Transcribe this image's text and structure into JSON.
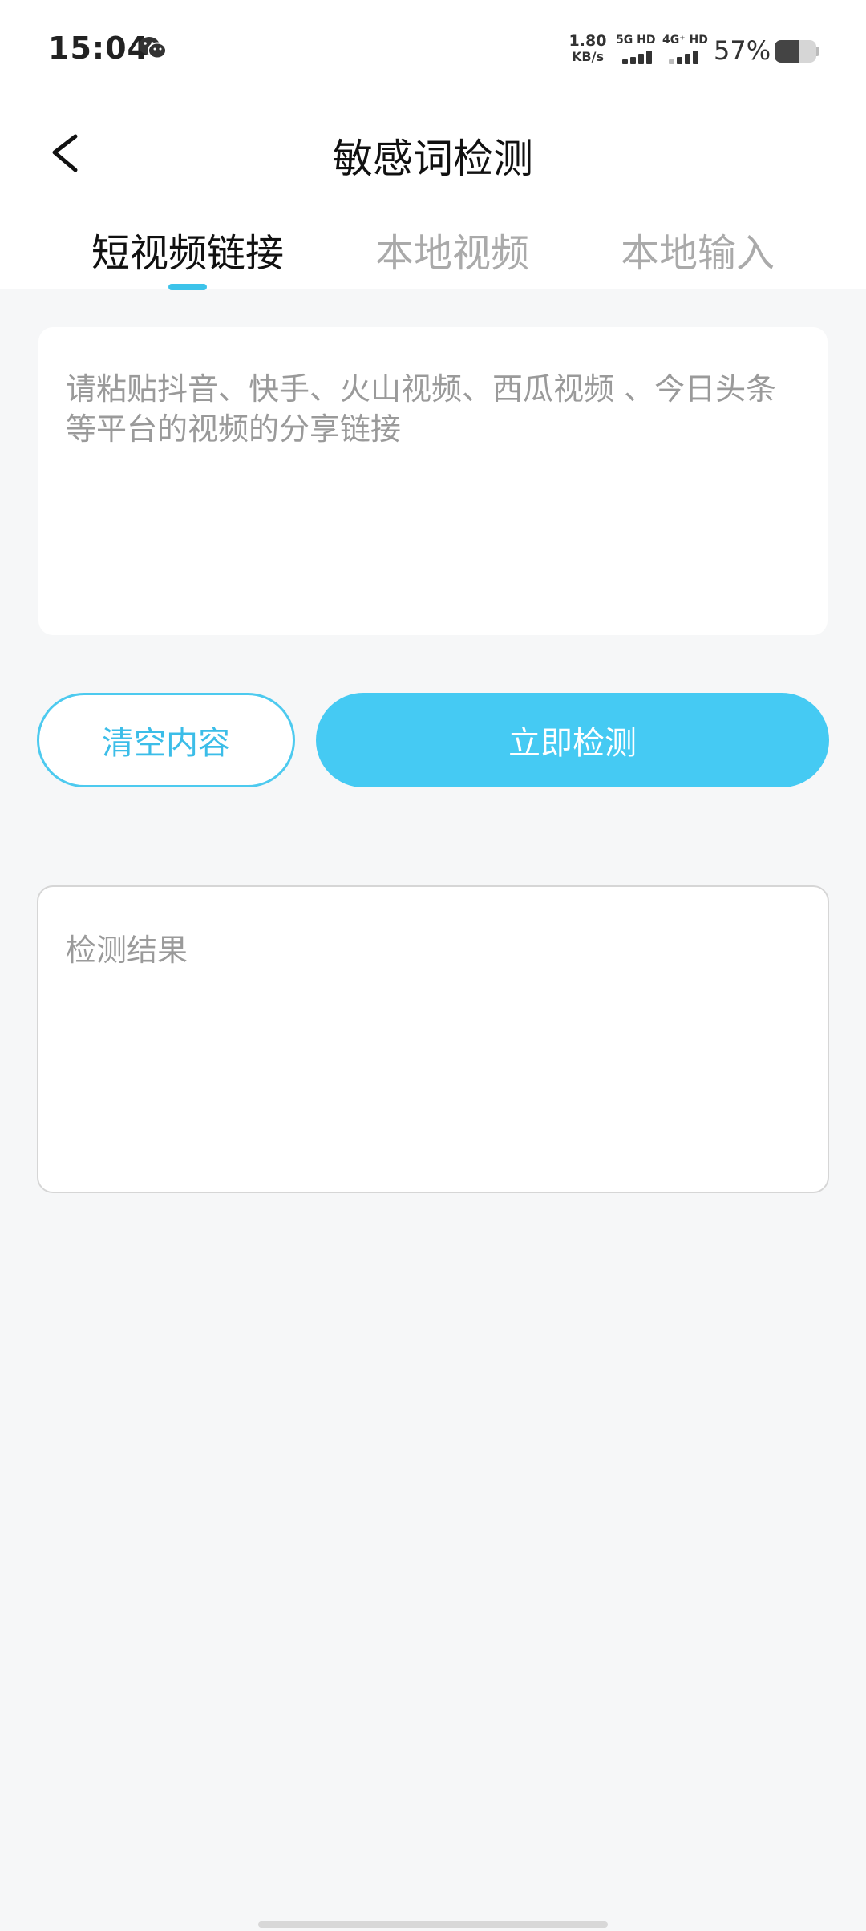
{
  "status_bar": {
    "time": "15:04",
    "app_icon": "wechat-icon",
    "net_speed_value": "1.80",
    "net_speed_unit": "KB/s",
    "sim1_label": "5G HD",
    "sim2_label": "4G⁺ HD",
    "battery_percent": "57%",
    "battery_level": 0.57
  },
  "header": {
    "back_icon": "back-arrow-icon",
    "title": "敏感词检测"
  },
  "tabs": [
    {
      "label": "短视频链接",
      "active": true
    },
    {
      "label": "本地视频",
      "active": false
    },
    {
      "label": "本地输入",
      "active": false
    }
  ],
  "input": {
    "placeholder": "请粘贴抖音、快手、火山视频、西瓜视频 、今日头条等平台的视频的分享链接",
    "value": ""
  },
  "buttons": {
    "clear_label": "清空内容",
    "detect_label": "立即检测"
  },
  "result": {
    "placeholder": "检测结果"
  },
  "colors": {
    "accent": "#45caf3",
    "accent_border": "#4dcaef",
    "page_background": "#f6f7f8"
  }
}
